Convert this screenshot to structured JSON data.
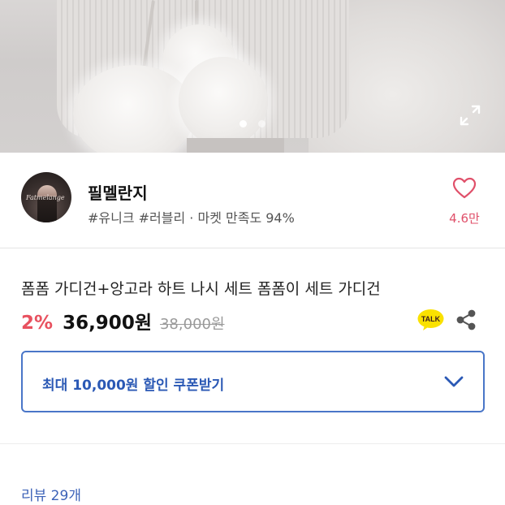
{
  "seller": {
    "name": "필멜란지",
    "tags": "#유니크 #러블리 · 마켓 만족도 94%",
    "avatar_text": "Fatmelange",
    "likes": "4.6만"
  },
  "product": {
    "title": "폼폼 가디건+앙고라 하트 나시 세트 폼폼이 세트 가디건",
    "discount": "2%",
    "price": "36,900원",
    "original_price": "38,000원"
  },
  "coupon": {
    "label": "최대 10,000원 할인 쿠폰받기"
  },
  "reviews": {
    "link_text": "리뷰 29개"
  },
  "gallery": {
    "pages": 2,
    "current_page": 1
  },
  "icons": {
    "like": "heart-icon",
    "talk": "kakao-talk-icon",
    "share": "share-icon",
    "expand": "fullscreen-icon",
    "coupon_toggle": "chevron-down-icon"
  },
  "colors": {
    "accent_red": "#e8515f",
    "like_pink": "#e0506a",
    "coupon_blue": "#4a76c8",
    "talk_yellow": "#fae100"
  }
}
